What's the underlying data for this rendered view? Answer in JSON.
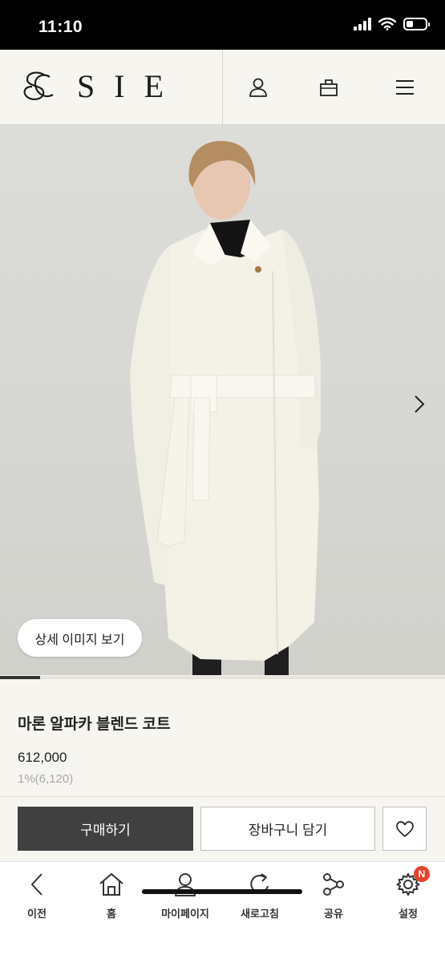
{
  "status_bar": {
    "time": "11:10"
  },
  "header": {
    "brand_name": "SIE",
    "icons": [
      "user-icon",
      "bag-icon",
      "menu-icon"
    ]
  },
  "hero": {
    "detail_button_label": "상세 이미지 보기",
    "next_icon": "chevron-right-icon",
    "slide_progress": 0.09
  },
  "product": {
    "name": "마론 알파카 블렌드 코트",
    "price": "612,000",
    "points": "1%(6,120)"
  },
  "actions": {
    "buy_label": "구매하기",
    "cart_label": "장바구니 담기",
    "wish_icon": "heart-icon"
  },
  "nav": {
    "items": [
      {
        "label": "이전",
        "icon": "back-icon"
      },
      {
        "label": "홈",
        "icon": "home-icon"
      },
      {
        "label": "마이페이지",
        "icon": "person-icon"
      },
      {
        "label": "새로고침",
        "icon": "refresh-icon"
      },
      {
        "label": "공유",
        "icon": "share-icon"
      },
      {
        "label": "설정",
        "icon": "gear-icon",
        "badge": "N"
      }
    ]
  },
  "colors": {
    "accent_dark": "#404040",
    "badge_red": "#e8432e",
    "page_bg": "#f7f5ef"
  }
}
